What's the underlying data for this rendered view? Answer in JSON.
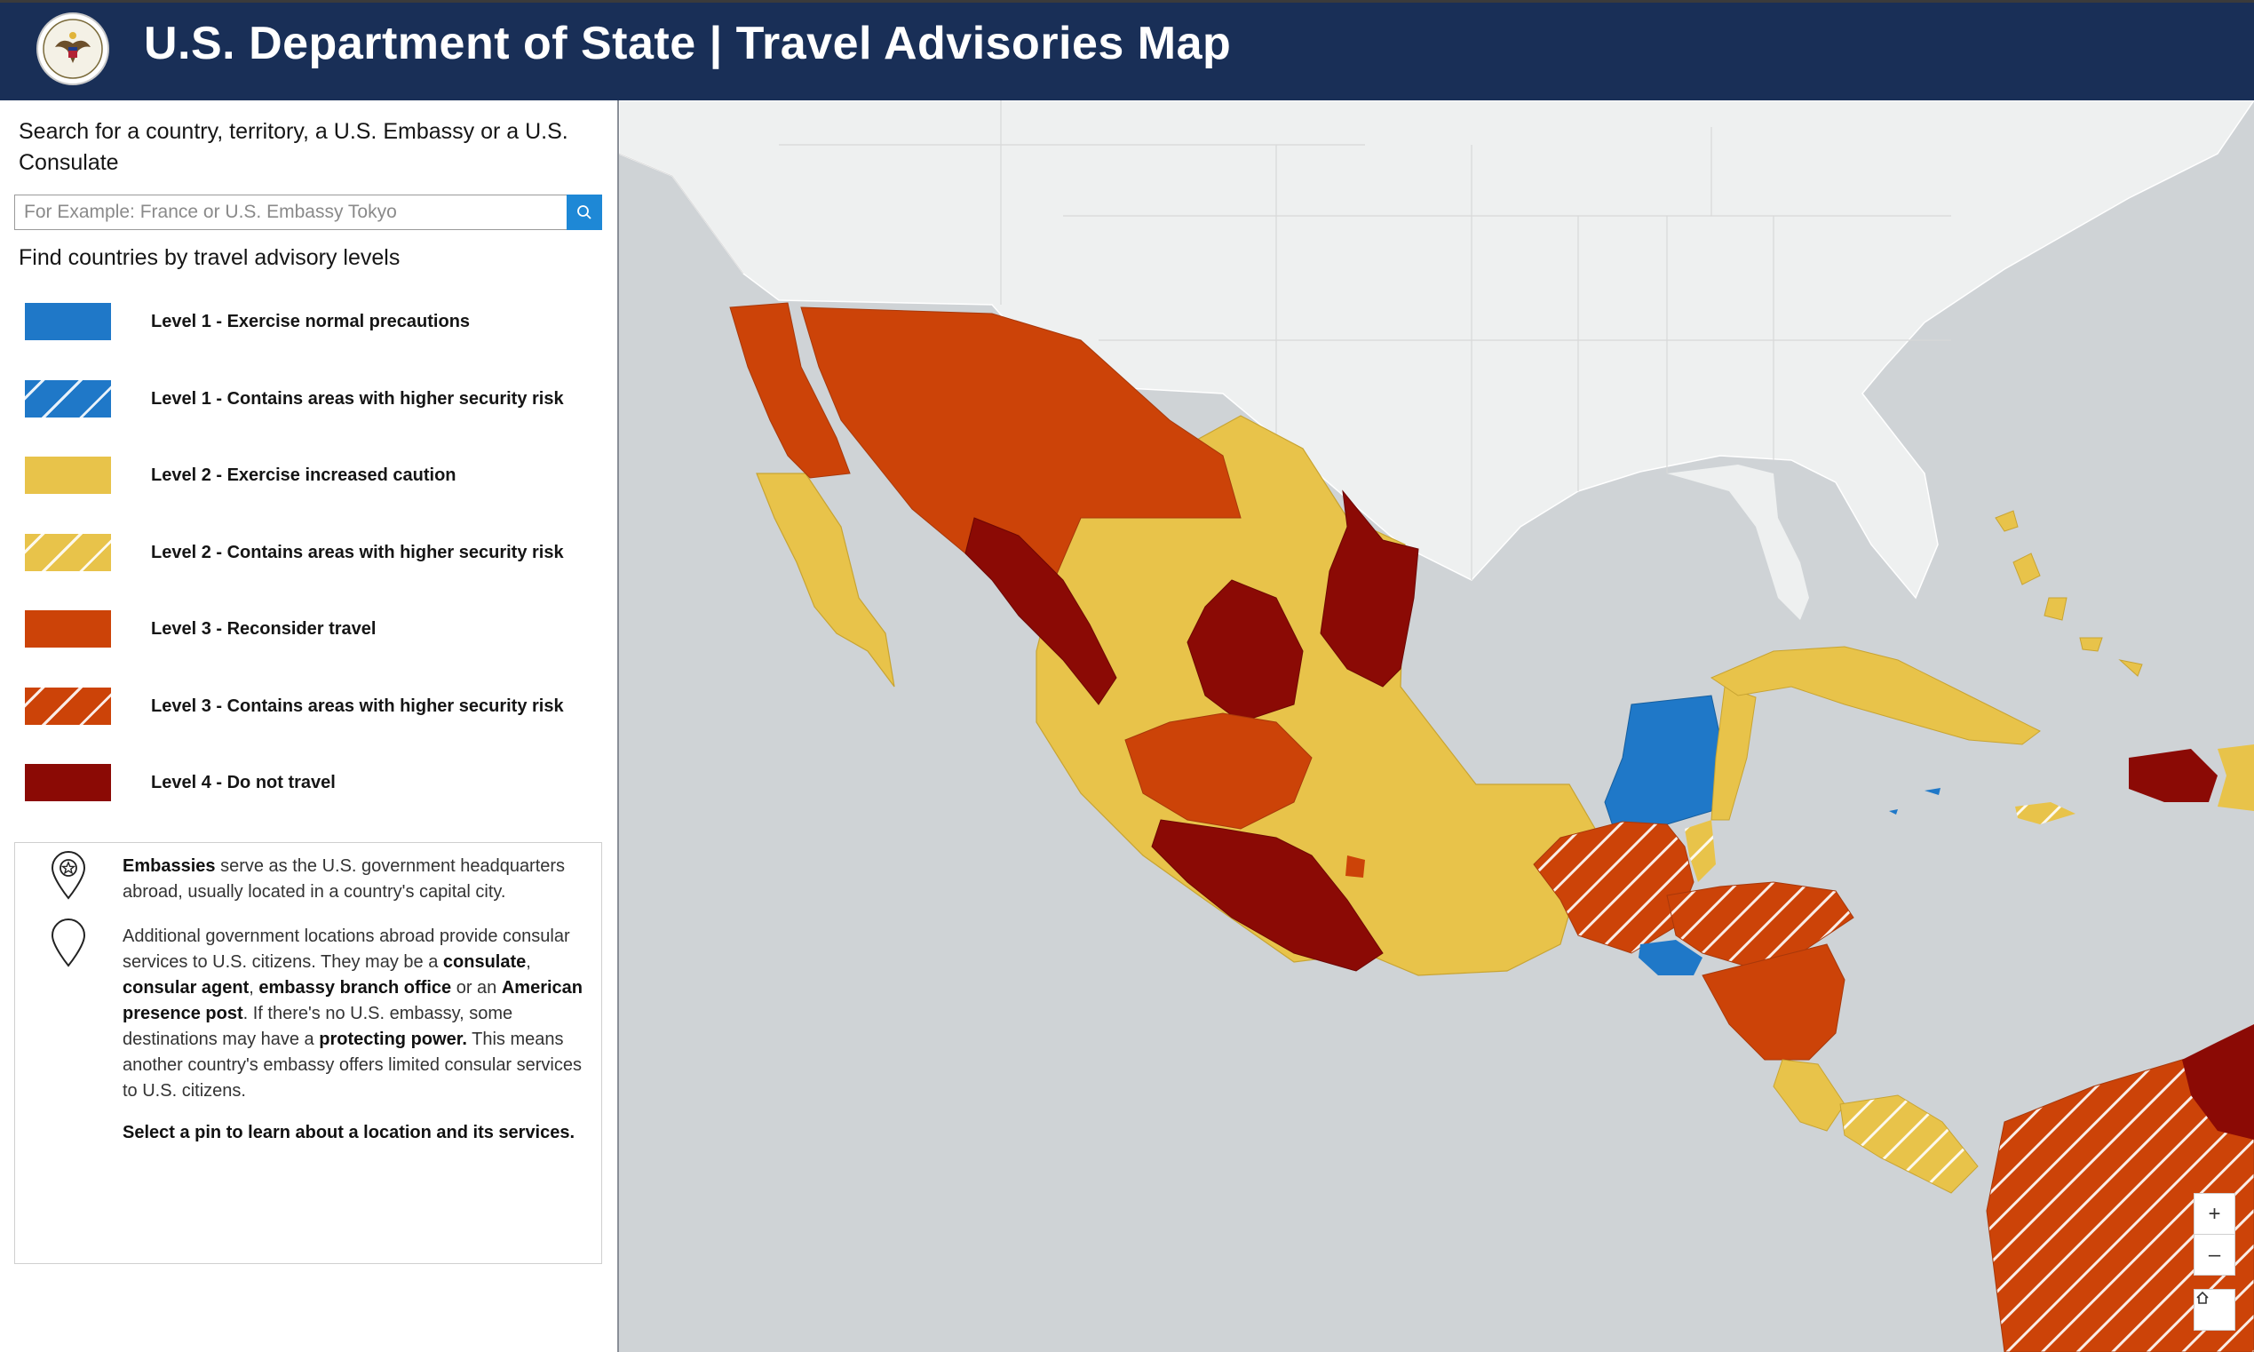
{
  "header": {
    "title": "U.S. Department of State | Travel Advisories Map",
    "seal_icon": "state-department-seal",
    "background": "#192f57"
  },
  "search": {
    "heading": "Search for a country, territory, a U.S. Embassy or a U.S. Consulate",
    "placeholder": "For Example: France or U.S. Embassy Tokyo",
    "button_icon": "search-icon",
    "button_color": "#1e88d6"
  },
  "filter": {
    "heading": "Find countries by travel advisory levels",
    "levels": [
      {
        "label": "Level 1 - Exercise normal precautions",
        "color": "#1f78c8",
        "pattern": "solid"
      },
      {
        "label": "Level 1 - Contains areas with higher security risk",
        "color": "#1f78c8",
        "pattern": "hatched"
      },
      {
        "label": "Level 2 - Exercise increased caution",
        "color": "#e8c34a",
        "pattern": "solid"
      },
      {
        "label": "Level 2 - Contains areas with higher security risk",
        "color": "#e8c34a",
        "pattern": "hatched"
      },
      {
        "label": "Level 3 - Reconsider travel",
        "color": "#cc4308",
        "pattern": "solid"
      },
      {
        "label": "Level 3 - Contains areas with higher security risk",
        "color": "#cc4308",
        "pattern": "hatched"
      },
      {
        "label": "Level 4 - Do not travel",
        "color": "#8b0a05",
        "pattern": "solid"
      }
    ]
  },
  "info": {
    "embassy_bold": "Embassies",
    "embassy_text": " serve as the U.S. government headquarters abroad, usually located in a country's capital city.",
    "other_1": "Additional government locations abroad provide consular services to U.S. citizens. They may be a ",
    "other_b1": "consulate",
    "other_2": ", ",
    "other_b2": "consular agent",
    "other_3": ", ",
    "other_b3": "embassy branch office",
    "other_4": " or an ",
    "other_b4": "American presence post",
    "other_5": ". If there's no U.S. embassy, some destinations may have a ",
    "other_b5": "protecting power.",
    "other_6": " This means another country's embassy offers limited consular services to U.S. citizens.",
    "cta": "Select a pin to learn about a location and its services.",
    "embassy_icon": "embassy-star-pin-icon",
    "location_icon": "location-pin-icon"
  },
  "map_controls": {
    "zoom_in": "+",
    "zoom_out": "–",
    "home_icon": "home-icon"
  }
}
